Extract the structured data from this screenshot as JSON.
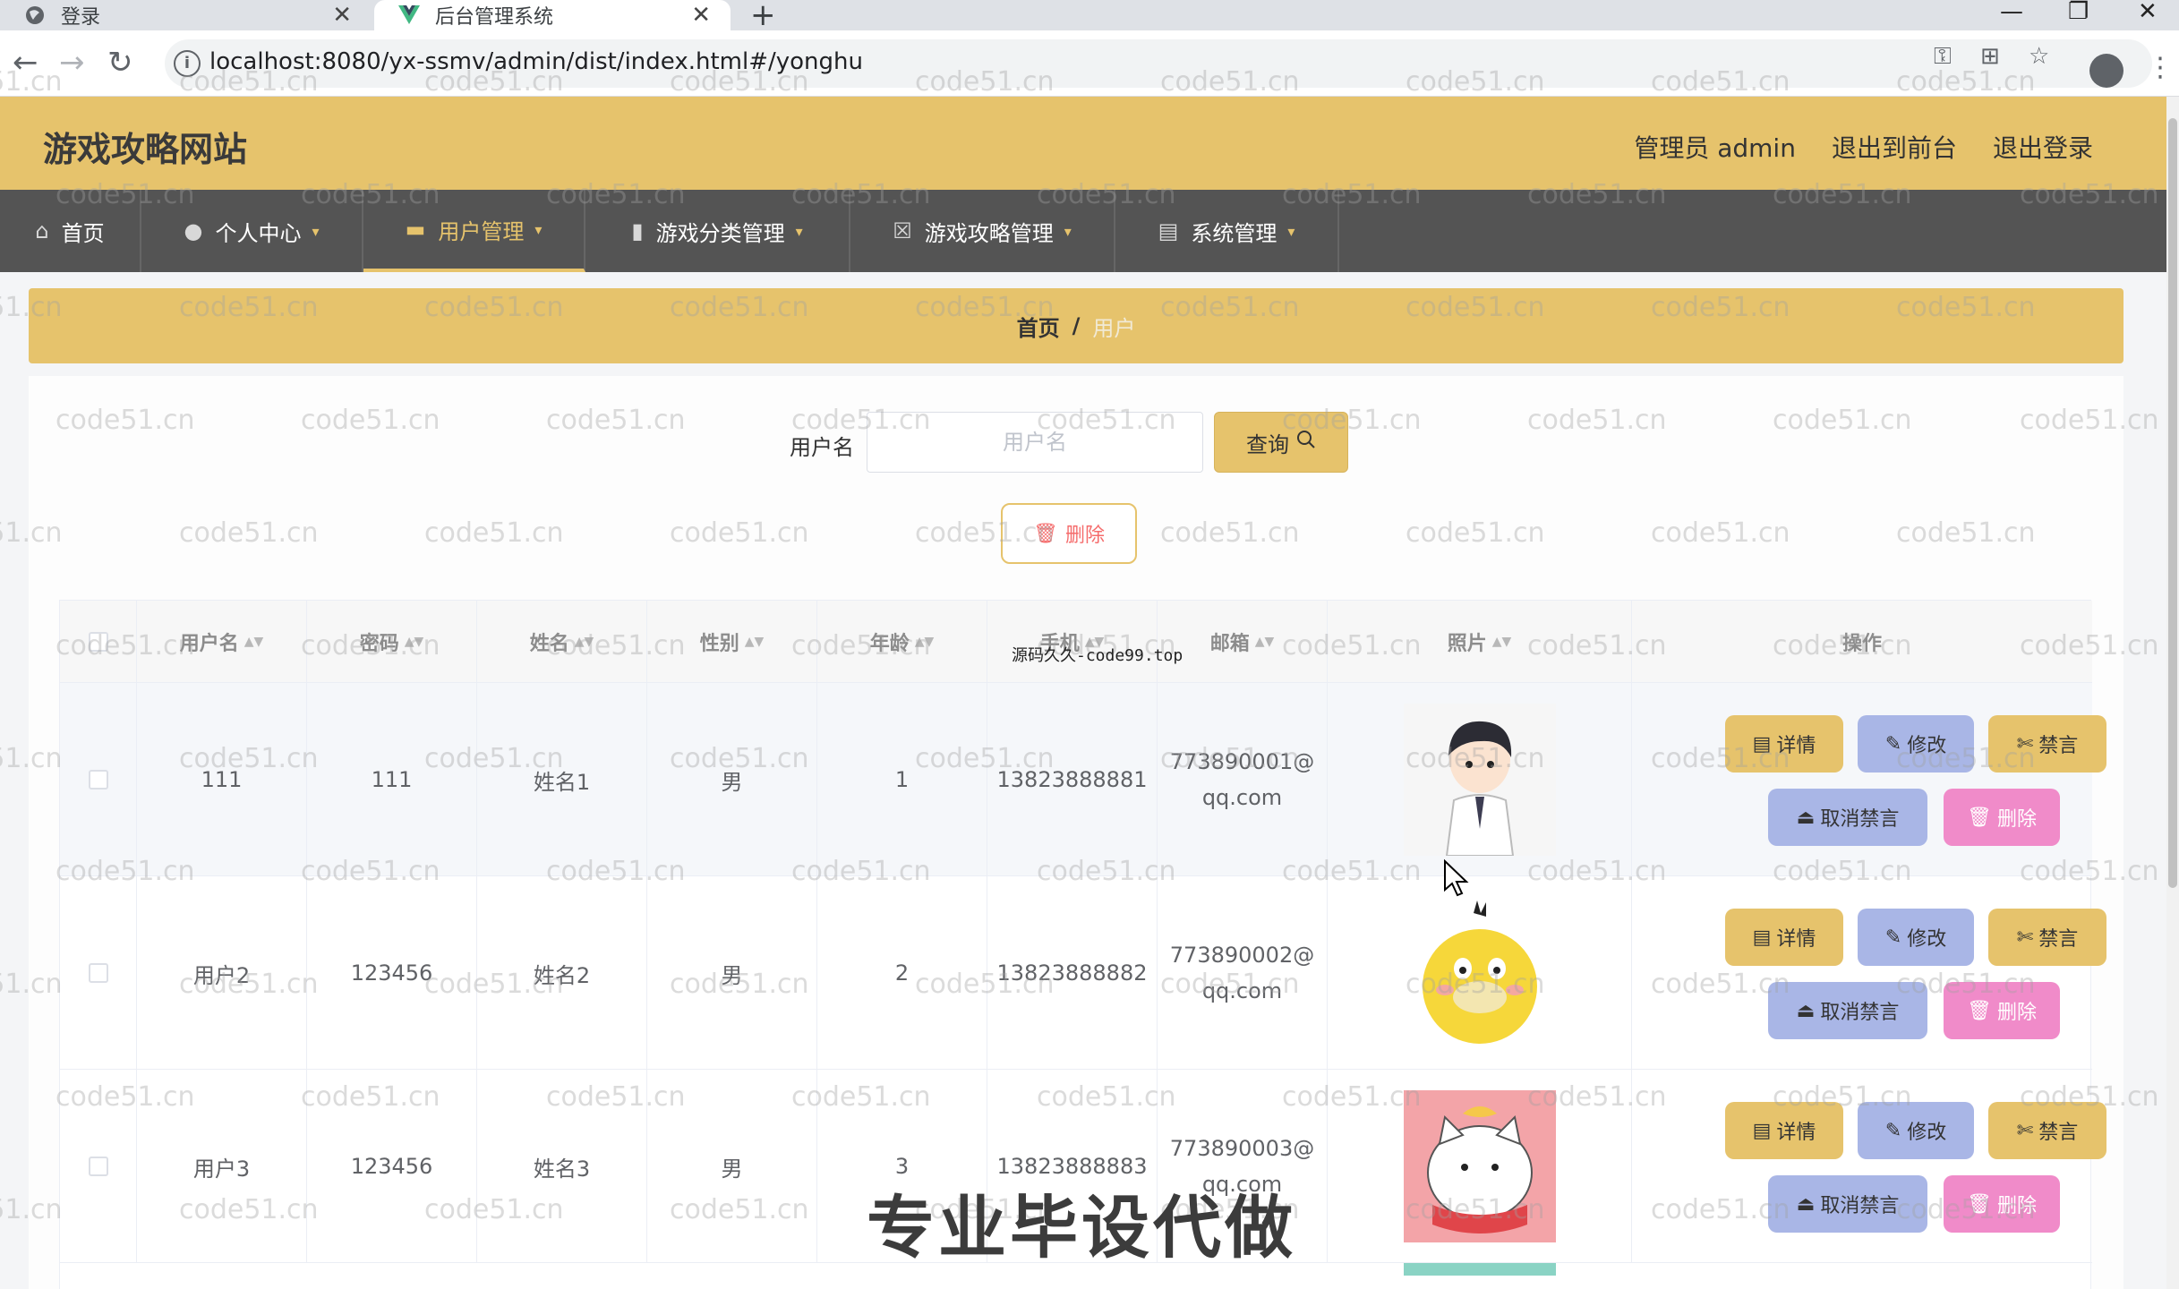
{
  "browser": {
    "tabs": [
      {
        "title": "登录",
        "active": false
      },
      {
        "title": "后台管理系统",
        "active": true
      }
    ],
    "new_tab": "+",
    "url": "localhost:8080/yx-ssmv/admin/dist/index.html#/yonghu",
    "window_controls": {
      "minimize": "—",
      "restore": "❐",
      "close": "✕"
    }
  },
  "header": {
    "site_title": "游戏攻略网站",
    "admin_label": "管理员 admin",
    "to_front": "退出到前台",
    "logout": "退出登录"
  },
  "nav": [
    {
      "label": "首页",
      "icon": "home-icon",
      "caret": false
    },
    {
      "label": "个人中心",
      "icon": "user-icon",
      "caret": true
    },
    {
      "label": "用户管理",
      "icon": "briefcase-icon",
      "caret": true,
      "active": true
    },
    {
      "label": "游戏分类管理",
      "icon": "chart-icon",
      "caret": true
    },
    {
      "label": "游戏攻略管理",
      "icon": "doc-x-icon",
      "caret": true
    },
    {
      "label": "系统管理",
      "icon": "clipboard-icon",
      "caret": true
    }
  ],
  "breadcrumb": {
    "home": "首页",
    "separator": "/",
    "current": "用户"
  },
  "search": {
    "label": "用户名",
    "placeholder": "用户名",
    "button": "查询",
    "delete_button": "删除"
  },
  "table": {
    "columns": [
      "用户名",
      "密码",
      "姓名",
      "性别",
      "年龄",
      "手机",
      "邮箱",
      "照片",
      "操作"
    ],
    "rows": [
      {
        "username": "111",
        "password": "111",
        "name": "姓名1",
        "gender": "男",
        "age": "1",
        "phone": "13823888881",
        "email_1": "773890001@",
        "email_2": "qq.com"
      },
      {
        "username": "用户2",
        "password": "123456",
        "name": "姓名2",
        "gender": "男",
        "age": "2",
        "phone": "13823888882",
        "email_1": "773890002@",
        "email_2": "qq.com"
      },
      {
        "username": "用户3",
        "password": "123456",
        "name": "姓名3",
        "gender": "男",
        "age": "3",
        "phone": "13823888883",
        "email_1": "773890003@",
        "email_2": "qq.com"
      }
    ],
    "actions": {
      "detail": "详情",
      "edit": "修改",
      "ban": "禁言",
      "unban": "取消禁言",
      "delete": "删除"
    }
  },
  "overlay": {
    "watermark": "code51.cn",
    "source_note": "源码久久-code99.top",
    "promo": "专业毕设代做"
  },
  "colors": {
    "header": "#e6c36c",
    "nav": "#545454",
    "edit_button": "#a9b6e6",
    "delete_button": "#f08bc9",
    "danger_text": "#f56c6c"
  }
}
